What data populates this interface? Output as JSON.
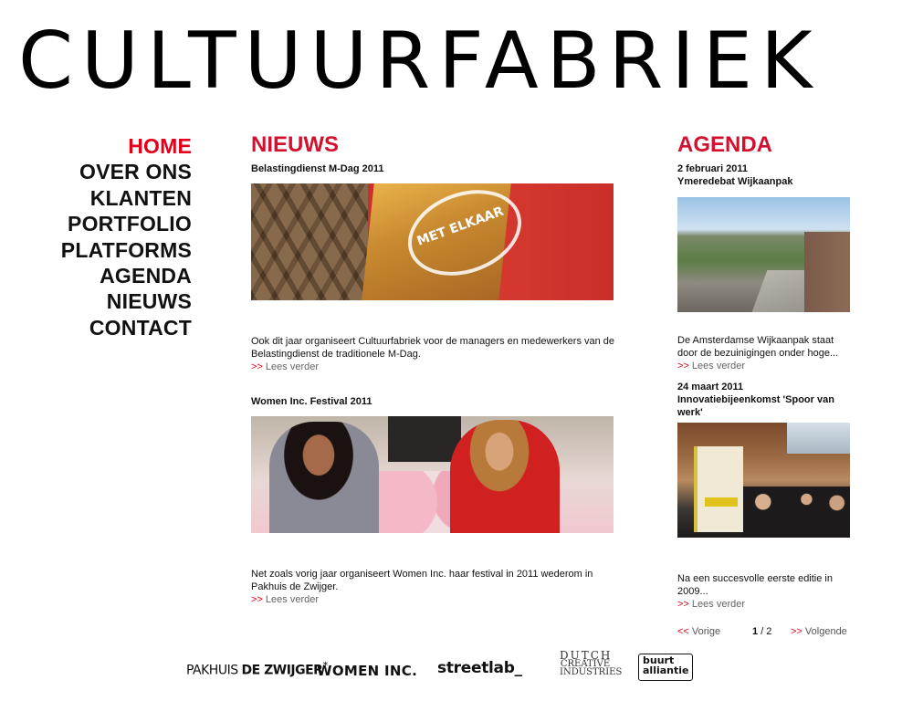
{
  "site": {
    "logo": "CULTUURFABRIEK"
  },
  "nav": {
    "items": [
      {
        "label": "HOME",
        "active": true
      },
      {
        "label": "OVER ONS"
      },
      {
        "label": "KLANTEN"
      },
      {
        "label": "PORTFOLIO"
      },
      {
        "label": "PLATFORMS"
      },
      {
        "label": "AGENDA"
      },
      {
        "label": "NIEUWS"
      },
      {
        "label": "CONTACT"
      }
    ]
  },
  "news": {
    "title": "NIEUWS",
    "items": [
      {
        "title": "Belastingdienst M-Dag 2011",
        "image_overlay": "MET ELKAAR",
        "text": "Ook dit jaar organiseert Cultuurfabriek voor de managers en medewerkers van de Belastingdienst de traditionele M-Dag.",
        "more_arrow": ">>",
        "more_label": "Lees verder"
      },
      {
        "title": "Women Inc. Festival 2011",
        "text": "Net zoals vorig jaar organiseert Women Inc. haar festival in 2011 wederom in Pakhuis de Zwijger.",
        "more_arrow": ">>",
        "more_label": "Lees verder"
      }
    ]
  },
  "agenda": {
    "title": "AGENDA",
    "items": [
      {
        "date": "2 februari 2011",
        "title": "Ymeredebat Wijkaanpak",
        "text": "De Amsterdamse Wijkaanpak staat door de bezuinigingen onder hoge...",
        "more_arrow": ">>",
        "more_label": "Lees verder"
      },
      {
        "date": "24 maart 2011",
        "title": "Innovatiebijeenkomst 'Spoor van werk'",
        "text": "Na een succesvolle eerste editie in 2009...",
        "more_arrow": ">>",
        "more_label": "Lees verder"
      }
    ],
    "pager": {
      "prev_arrow": "<<",
      "prev_label": "Vorige",
      "current": "1",
      "total": "/ 2",
      "next_arrow": ">>",
      "next_label": "Volgende"
    }
  },
  "partners": {
    "pakhuis": {
      "text1": "PAKHUIS ",
      "text2": "DE ZWIJGER",
      "star": "*"
    },
    "women": "WOMEN INC.",
    "streetlab": "streetlab_",
    "dutch": {
      "line1": "DUTCH",
      "line2": "CREATIVE",
      "line3": "INDUSTRIES"
    },
    "buurt": {
      "line1": "buurt",
      "line2": "alliantie"
    }
  },
  "colors": {
    "accent": "#e2001a",
    "heading": "#d3102e"
  }
}
